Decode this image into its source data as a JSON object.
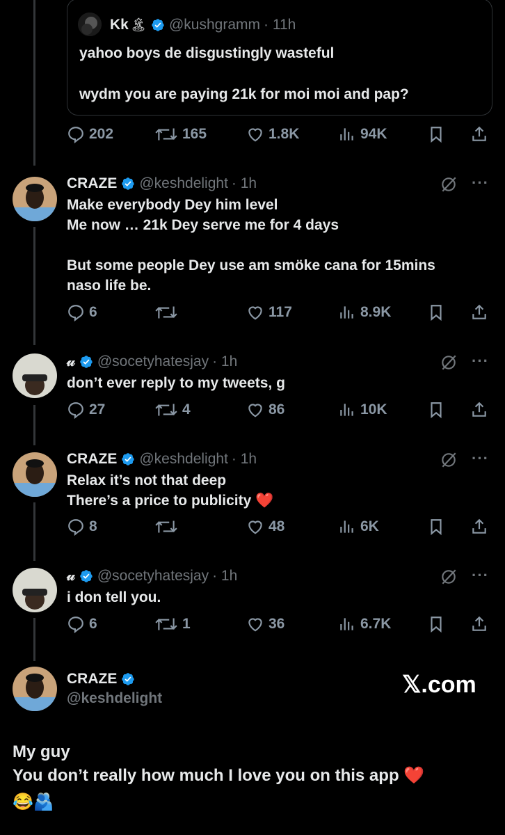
{
  "quote": {
    "name": "Kk",
    "name_emoji": "🏝",
    "handle": "@kushgramm",
    "time": "· 11h",
    "line1": "yahoo boys de disgustingly wasteful",
    "line2": "wydm you are paying 21k for moi moi and pap?",
    "stats": {
      "replies": "202",
      "reposts": "165",
      "likes": "1.8K",
      "views": "94K"
    }
  },
  "replies": [
    {
      "name": "CRAZE",
      "handle": "@keshdelight",
      "time": "· 1h",
      "text": "Make everybody Dey him level\nMe now … 21k Dey serve me for 4 days\n\nBut some people Dey use am smöke cana for 15mins\nnaso life be.",
      "stats": {
        "replies": "6",
        "reposts": "",
        "likes": "117",
        "views": "8.9K"
      }
    },
    {
      "name": "𝓊",
      "handle": "@socetyhatesjay",
      "time": "· 1h",
      "text": "don’t ever reply to my tweets, g",
      "stats": {
        "replies": "27",
        "reposts": "4",
        "likes": "86",
        "views": "10K"
      }
    },
    {
      "name": "CRAZE",
      "handle": "@keshdelight",
      "time": "· 1h",
      "text": "Relax it’s not that deep\nThere’s a price to publicity ❤️",
      "stats": {
        "replies": "8",
        "reposts": "",
        "likes": "48",
        "views": "6K"
      }
    },
    {
      "name": "𝓊",
      "handle": "@socetyhatesjay",
      "time": "· 1h",
      "text": "i don tell you.",
      "stats": {
        "replies": "6",
        "reposts": "1",
        "likes": "36",
        "views": "6.7K"
      }
    }
  ],
  "main": {
    "name": "CRAZE",
    "handle": "@keshdelight",
    "watermark": "𝕏.com",
    "line1": "My guy",
    "line2": "You don’t really how much I love you on this app ❤️",
    "line3": "😂🫂"
  },
  "colors": {
    "verified": "#1d9bf0",
    "heart_emoji": "#e0245e"
  }
}
